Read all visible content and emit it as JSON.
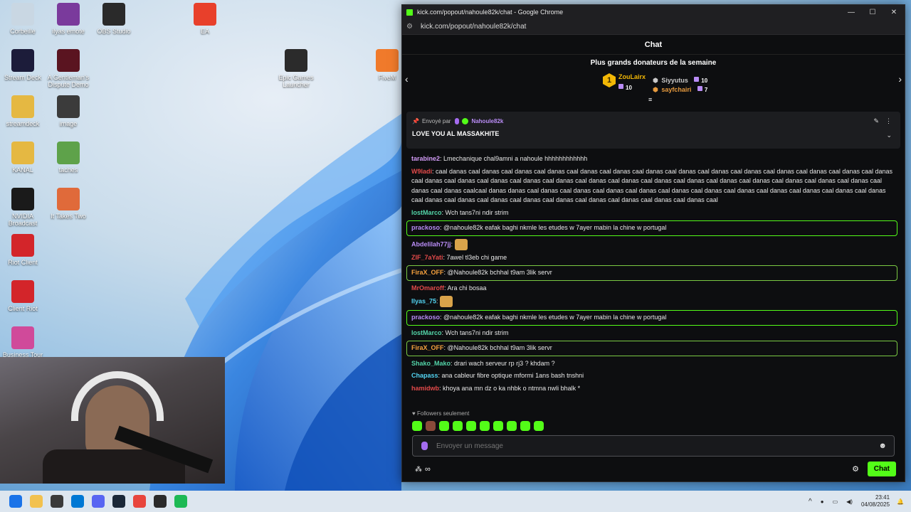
{
  "desktop_icons": [
    {
      "label": "Corbeille",
      "icon": "recycle-bin-icon",
      "color": "#c9d7e3"
    },
    {
      "label": "ilyas emote",
      "icon": "winrar-icon",
      "color": "#7a3a9c"
    },
    {
      "label": "OBS Studio",
      "icon": "obs-icon",
      "color": "#2a2a2a"
    },
    {
      "label": "EA",
      "icon": "ea-icon",
      "color": "#e8402b"
    },
    {
      "label": "Stream Deck",
      "icon": "stream-deck-icon",
      "color": "#1c1c3a"
    },
    {
      "label": "A Gentleman's Dispute Demo",
      "icon": "top-hat-icon",
      "color": "#5a1420"
    },
    {
      "label": "Epic Games Launcher",
      "icon": "epic-games-icon",
      "color": "#2b2b2b"
    },
    {
      "label": "FiveM",
      "icon": "fivem-icon",
      "color": "#f07a2b"
    },
    {
      "label": "streamdeck",
      "icon": "folder-icon",
      "color": "#e5b842"
    },
    {
      "label": "image",
      "icon": "image-file-icon",
      "color": "#3b3b3b"
    },
    {
      "label": "KANAL",
      "icon": "folder-icon",
      "color": "#e5b842"
    },
    {
      "label": "taches",
      "icon": "notepad-icon",
      "color": "#5ea24a"
    },
    {
      "label": "NVIDIA Broadcast",
      "icon": "nvidia-icon",
      "color": "#1a1a1a"
    },
    {
      "label": "It Takes Two",
      "icon": "it-takes-two-icon",
      "color": "#e06a3a"
    },
    {
      "label": "Riot Client",
      "icon": "riot-icon",
      "color": "#d3252a"
    },
    {
      "label": "Client Riot",
      "icon": "riot-icon",
      "color": "#d3252a"
    },
    {
      "label": "Business Tour",
      "icon": "business-tour-icon",
      "color": "#d04a9a"
    }
  ],
  "window": {
    "title": "kick.com/popout/nahoule82k/chat - Google Chrome",
    "url": "kick.com/popout/nahoule82k/chat"
  },
  "chat": {
    "header": "Chat",
    "donors_title": "Plus grands donateurs de la semaine",
    "top_donor": {
      "rank": "1",
      "name": "ZouLairx",
      "amount": "10",
      "color": "#f2b705"
    },
    "donors": [
      {
        "name": "Siyyutus",
        "amount": "10",
        "color": "#c9c9c9"
      },
      {
        "name": "sayfchairi",
        "amount": "7",
        "color": "#e69a3e"
      }
    ],
    "pinned": {
      "sent_by_label": "Envoyé par",
      "sender": "Nahoule82k",
      "message": "LOVE YOU AL MASSAKHITE"
    },
    "messages": [
      {
        "user": "tarabine2",
        "color": "#d39cf7",
        "text": "Lmechanique chal9amni a nahoule hhhhhhhhhhhh",
        "hl": false
      },
      {
        "user": "W9ladi",
        "color": "#e34a4a",
        "text": "caal danas caal danas caal danas caal danas caal danas caal danas caal danas caal danas caal danas caal danas caal danas caal danas caal danas caal danas caal danas caal danas caal danas caal danas caal danas caal danas caal danas caal danas caal danas caal danas caal danas caal danas caal danas caal danas caal danas caal danas caalcaal danas danas caal danas caal danas caal danas caal danas caal danas caal danas caal danas caal danas caal danas caal danas caal danas caal danas caal danas caal danas caal danas caal danas caal danas caal danas caal danas caal danas caal",
        "hl": false
      },
      {
        "user": "lostMarco",
        "color": "#53d4a8",
        "text": "Wch tans7ni ndir strim",
        "hl": false
      },
      {
        "user": "prackoso",
        "color": "#b98cf6",
        "text": "@nahoule82k eafak baghi nkmle les etudes w 7ayer mabin la chine w portugal",
        "hl": true
      },
      {
        "user": "Abdelilah77jj",
        "color": "#b98cf6",
        "text": "",
        "hl": false
      },
      {
        "user": "ZIF_7aYati",
        "color": "#e34a4a",
        "text": "7awel tl3eb chi game",
        "hl": false
      },
      {
        "user": "FiraX_OFF",
        "color": "#f7a23e",
        "text": "@Nahoule82k bchhal t9am 3lik servr",
        "hl": true
      },
      {
        "user": "MrOmaroff",
        "color": "#e34a4a",
        "text": "Ara chi bosaa",
        "hl": false
      },
      {
        "user": "Ilyas_75",
        "color": "#53d4f2",
        "text": "",
        "hl": false
      },
      {
        "user": "prackoso",
        "color": "#b98cf6",
        "text": "@nahoule82k eafak baghi nkmle les etudes w 7ayer mabin la chine w portugal",
        "hl": true
      },
      {
        "user": "lostMarco",
        "color": "#53d4a8",
        "text": "Wch tans7ni ndir strim",
        "hl": false
      },
      {
        "user": "FiraX_OFF",
        "color": "#f7a23e",
        "text": "@Nahoule82k bchhal t9am 3lik servr",
        "hl": true
      },
      {
        "user": "Shako_Mako",
        "color": "#53d4a8",
        "text": "drari wach serveur rp rj3 ? khdam ?",
        "hl": false
      },
      {
        "user": "Chapass",
        "color": "#53d4f2",
        "text": "ana cableur fibre optique mformi 1ans bash tnshni",
        "hl": false
      },
      {
        "user": "hamidwb",
        "color": "#e34a4a",
        "text": "khoya ana mn dz o ka nhbk o ntmna nwli bhalk *",
        "hl": false
      }
    ],
    "followers_only": "Followers seulement",
    "input_placeholder": "Envoyer un message",
    "send_label": "Chat"
  },
  "taskbar": {
    "time": "23:41",
    "date": "04/08/2025",
    "apps": [
      "windows-start-icon",
      "file-explorer-icon",
      "store-icon",
      "outlook-icon",
      "discord-icon",
      "steam-icon",
      "chrome-icon",
      "obs-icon",
      "spotify-icon"
    ]
  }
}
